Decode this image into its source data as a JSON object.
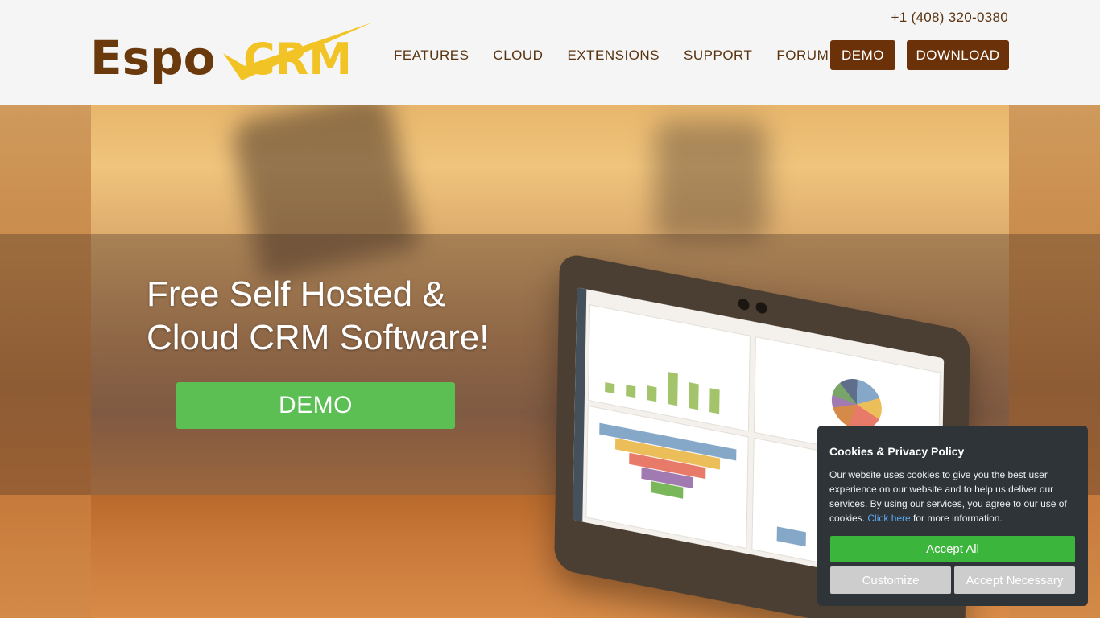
{
  "brand": {
    "name": "EspoCRM",
    "logo_text_dark": "Espo",
    "logo_text_accent": "CRM",
    "colors": {
      "dark_brown": "#6b3109",
      "logo_brown": "#6b3a0c",
      "logo_yellow": "#f2c324"
    }
  },
  "header": {
    "phone": "+1 (408) 320-0380",
    "nav": {
      "features": "FEATURES",
      "cloud": "CLOUD",
      "extensions": "EXTENSIONS",
      "support": "SUPPORT",
      "forum": "FORUM"
    },
    "demo_button": "DEMO",
    "download_button": "DOWNLOAD"
  },
  "hero": {
    "title_line1": "Free Self Hosted &",
    "title_line2": "Cloud CRM Software!",
    "demo_button": "DEMO",
    "accent_color": "#5bbf53"
  },
  "cookie_banner": {
    "title": "Cookies & Privacy Policy",
    "text_before_link": "Our website uses cookies to give you the best user experience on our website and to help us deliver our services. By using our services, you agree to our use of cookies. ",
    "link_text": "Click here",
    "text_after_link": " for more information.",
    "accept_all": "Accept All",
    "customize": "Customize",
    "accept_necessary": "Accept Necessary",
    "accept_color": "#3bb53b"
  }
}
